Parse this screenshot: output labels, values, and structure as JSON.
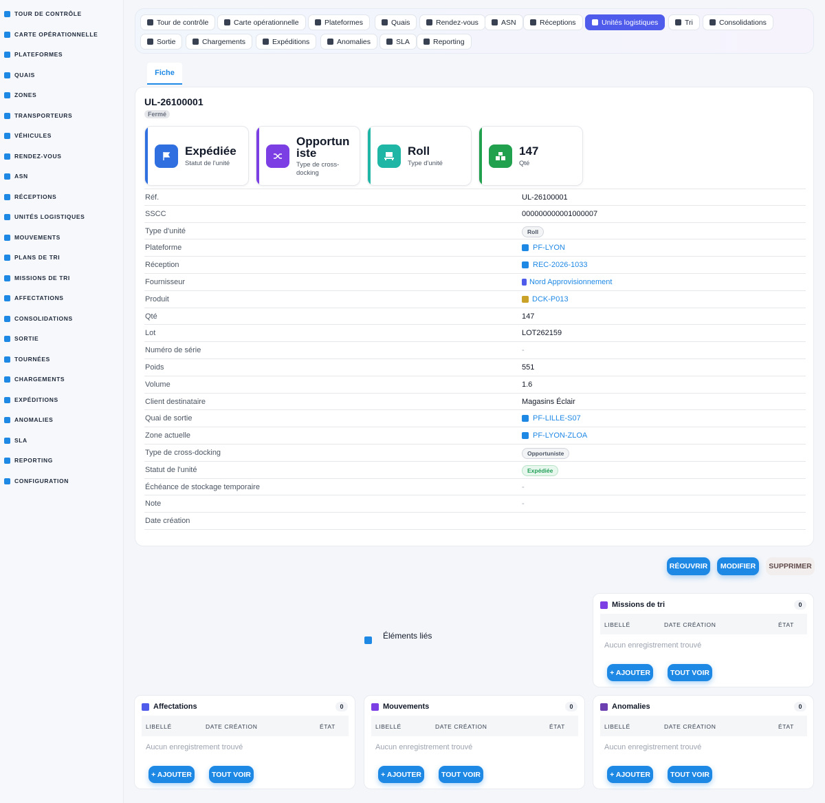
{
  "sidebar": {
    "items": [
      {
        "label": "TOUR DE CONTRÔLE",
        "icon": "gauge-icon"
      },
      {
        "label": "CARTE OPÉRATIONNELLE",
        "icon": "map-icon"
      },
      {
        "label": "PLATEFORMES",
        "icon": "warehouse-icon"
      },
      {
        "label": "QUAIS",
        "icon": "dock-icon"
      },
      {
        "label": "ZONES",
        "icon": "grid-icon"
      },
      {
        "label": "TRANSPORTEURS",
        "icon": "truck-icon"
      },
      {
        "label": "VÉHICULES",
        "icon": "van-icon"
      },
      {
        "label": "RENDEZ-VOUS",
        "icon": "calendar-icon"
      },
      {
        "label": "ASN",
        "icon": "document-icon"
      },
      {
        "label": "RÉCEPTIONS",
        "icon": "inbox-icon"
      },
      {
        "label": "UNITÉS LOGISTIQUES",
        "icon": "pallet-icon"
      },
      {
        "label": "MOUVEMENTS",
        "icon": "arrows-icon"
      },
      {
        "label": "PLANS DE TRI",
        "icon": "list-icon"
      },
      {
        "label": "MISSIONS DE TRI",
        "icon": "tasks-icon"
      },
      {
        "label": "AFFECTATIONS",
        "icon": "shuffle-icon"
      },
      {
        "label": "CONSOLIDATIONS",
        "icon": "layers-icon"
      },
      {
        "label": "SORTIE",
        "icon": "exit-icon"
      },
      {
        "label": "TOURNÉES",
        "icon": "route-icon"
      },
      {
        "label": "CHARGEMENTS",
        "icon": "truck-loading-icon"
      },
      {
        "label": "EXPÉDITIONS",
        "icon": "shipping-icon"
      },
      {
        "label": "ANOMALIES",
        "icon": "warning-icon"
      },
      {
        "label": "SLA",
        "icon": "stopwatch-icon"
      },
      {
        "label": "REPORTING",
        "icon": "chart-pie-icon"
      },
      {
        "label": "CONFIGURATION",
        "icon": "gear-icon"
      }
    ]
  },
  "topnav": {
    "chips": [
      {
        "label": "Tour de contrôle",
        "icon": "gauge-icon"
      },
      {
        "label": "Carte opérationnelle",
        "icon": "map-icon"
      },
      {
        "label": "Plateformes",
        "icon": "warehouse-icon"
      },
      {
        "label": "Quais",
        "icon": "dock-icon"
      },
      {
        "label": "Rendez-vous",
        "icon": "calendar-icon"
      },
      {
        "label": "ASN",
        "icon": "document-icon"
      },
      {
        "label": "Réceptions",
        "icon": "inbox-icon"
      },
      {
        "label": "Unités logistiques",
        "icon": "pallet-icon"
      },
      {
        "label": "Tri",
        "icon": "list-icon"
      },
      {
        "label": "Consolidations",
        "icon": "layers-icon"
      },
      {
        "label": "Sortie",
        "icon": "exit-icon"
      },
      {
        "label": "Chargements",
        "icon": "truck-loading-icon"
      },
      {
        "label": "Expéditions",
        "icon": "shipping-icon"
      },
      {
        "label": "Anomalies",
        "icon": "warning-icon"
      },
      {
        "label": "SLA",
        "icon": "stopwatch-icon"
      },
      {
        "label": "Reporting",
        "icon": "chart-pie-icon"
      }
    ],
    "active_index": 7
  },
  "tab": {
    "label": "Fiche"
  },
  "record": {
    "title": "UL-26100001",
    "state": "Fermé",
    "kpis": [
      {
        "value": "Expédiée",
        "label": "Statut de l'unité",
        "color": "#2f6fe0",
        "icon": "flag-icon"
      },
      {
        "value": "Opportun iste",
        "label": "Type de cross-docking",
        "color": "#7b3fe4",
        "icon": "shuffle-icon"
      },
      {
        "value": "Roll",
        "label": "Type d'unité",
        "color": "#1fb6a6",
        "icon": "pallet-icon"
      },
      {
        "value": "147",
        "label": "Qté",
        "color": "#21a04e",
        "icon": "boxes-icon"
      }
    ],
    "fields": [
      {
        "label": "Réf.",
        "value": "UL-26100001"
      },
      {
        "label": "SSCC",
        "value": "000000000001000007"
      },
      {
        "label": "Type d'unité",
        "value": "Roll"
      },
      {
        "label": "Plateforme",
        "value": "PF-LYON"
      },
      {
        "label": "Réception",
        "value": "REC-2026-1033"
      },
      {
        "label": "Fournisseur",
        "value": "Nord Approvisionnement"
      },
      {
        "label": "Produit",
        "value": "DCK-P013"
      },
      {
        "label": "Qté",
        "value": "147"
      },
      {
        "label": "Lot",
        "value": "LOT262159"
      },
      {
        "label": "Numéro de série",
        "value": "-"
      },
      {
        "label": "Poids",
        "value": "551"
      },
      {
        "label": "Volume",
        "value": "1.6"
      },
      {
        "label": "Client destinataire",
        "value": "Magasins Éclair"
      },
      {
        "label": "Quai de sortie",
        "value": "PF-LILLE-S07"
      },
      {
        "label": "Zone actuelle",
        "value": "PF-LYON-ZLOA"
      },
      {
        "label": "Type de cross-docking",
        "value": "Opportuniste"
      },
      {
        "label": "Statut de l'unité",
        "value": "Expédiée"
      },
      {
        "label": "Échéance de stockage temporaire",
        "value": "-"
      },
      {
        "label": "Note",
        "value": "-"
      },
      {
        "label": "Date création",
        "value": ""
      }
    ]
  },
  "actions": {
    "reopen": "RÉOUVRIR",
    "edit": "MODIFIER",
    "delete": "SUPPRIMER"
  },
  "linked": {
    "label": "Éléments liés"
  },
  "panels": [
    {
      "title": "Missions de tri",
      "count": "0",
      "icon": "tasks-icon",
      "color": "#7b3fe4"
    },
    {
      "title": "Affectations",
      "count": "0",
      "icon": "shuffle-icon",
      "color": "#4f5bea"
    },
    {
      "title": "Mouvements",
      "count": "0",
      "icon": "arrows-icon",
      "color": "#7b3fe4"
    },
    {
      "title": "Anomalies",
      "count": "0",
      "icon": "warning-icon",
      "color": "#6b3fb0"
    }
  ],
  "table": {
    "col_label": "LIBELLÉ",
    "col_date": "DATE CRÉATION",
    "col_state": "ÉTAT",
    "empty": "Aucun enregistrement trouvé"
  },
  "panel_actions": {
    "add": "+ AJOUTER",
    "view_all": "TOUT VOIR"
  },
  "colors": {
    "accent": "#1e88e5",
    "active_nav": "#4f5bea",
    "badge_green": "#22a058"
  }
}
